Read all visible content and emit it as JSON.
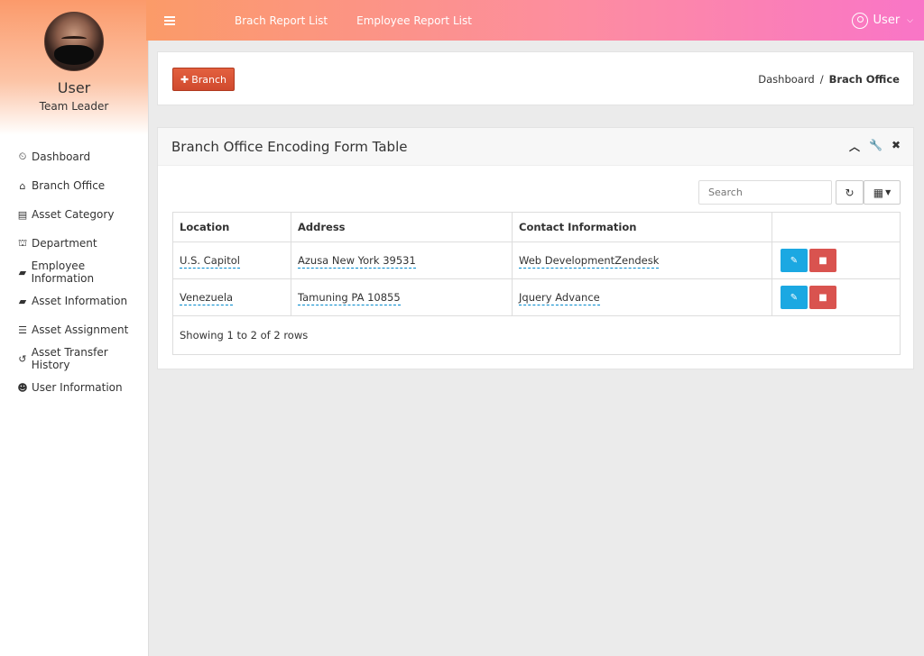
{
  "sidebar": {
    "user_name": "User",
    "user_role": "Team Leader",
    "items": [
      {
        "label": "Dashboard",
        "icon": "dashboard-icon"
      },
      {
        "label": "Branch Office",
        "icon": "home-icon"
      },
      {
        "label": "Asset Category",
        "icon": "file-icon"
      },
      {
        "label": "Department",
        "icon": "institution-icon"
      },
      {
        "label": "Employee Information",
        "icon": "folder-open-icon"
      },
      {
        "label": "Asset Information",
        "icon": "folder-open-icon"
      },
      {
        "label": "Asset Assignment",
        "icon": "list-icon"
      },
      {
        "label": "Asset Transfer History",
        "icon": "history-icon"
      },
      {
        "label": "User Information",
        "icon": "users-icon"
      }
    ]
  },
  "topbar": {
    "links": [
      "Brach Report List",
      "Employee Report List"
    ],
    "user_label": "User"
  },
  "header": {
    "add_button_label": "Branch",
    "breadcrumb_home": "Dashboard",
    "breadcrumb_current": "Brach Office"
  },
  "panel": {
    "title": "Branch Office Encoding Form Table",
    "search_placeholder": "Search",
    "columns": [
      "Location",
      "Address",
      "Contact Information",
      ""
    ],
    "rows": [
      {
        "location": "U.S. Capitol",
        "address": "Azusa New York 39531",
        "contact": "Web DevelopmentZendesk"
      },
      {
        "location": "Venezuela",
        "address": "Tamuning PA 10855",
        "contact": "Jquery Advance"
      }
    ],
    "footer_text": "Showing 1 to 2 of 2 rows"
  },
  "colors": {
    "topbar_start": "#fb9b68",
    "topbar_end": "#f975c7",
    "branch_button": "#d9543a",
    "edit_button": "#1ba8e2",
    "delete_button": "#d9534f"
  }
}
